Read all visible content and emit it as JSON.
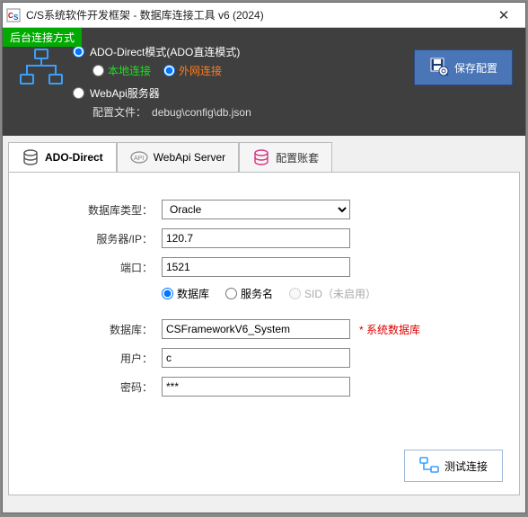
{
  "window": {
    "title": "C/S系统软件开发框架 - 数据库连接工具 v6 (2024)"
  },
  "connmode": {
    "badge": "后台连接方式",
    "ado_direct": "ADO-Direct模式(ADO直连模式)",
    "local": "本地连接",
    "external": "外网连接",
    "webapi": "WebApi服务器",
    "config_label": "配置文件：",
    "config_path": "debug\\config\\db.json",
    "save_button": "保存配置"
  },
  "tabs": {
    "ado": "ADO-Direct",
    "webapi": "WebApi Server",
    "account": "配置账套"
  },
  "form": {
    "db_type_label": "数据库类型：",
    "db_type_value": "Oracle",
    "server_label": "服务器/IP：",
    "server_value": "120.7",
    "port_label": "端口：",
    "port_value": "1521",
    "opt_database": "数据库",
    "opt_service": "服务名",
    "opt_sid": "SID（未启用）",
    "database_label": "数据库：",
    "database_value": "CSFrameworkV6_System",
    "database_note": "* 系统数据库",
    "user_label": "用户：",
    "user_value": "c",
    "password_label": "密码：",
    "password_value": "***",
    "test_button": "测试连接"
  }
}
